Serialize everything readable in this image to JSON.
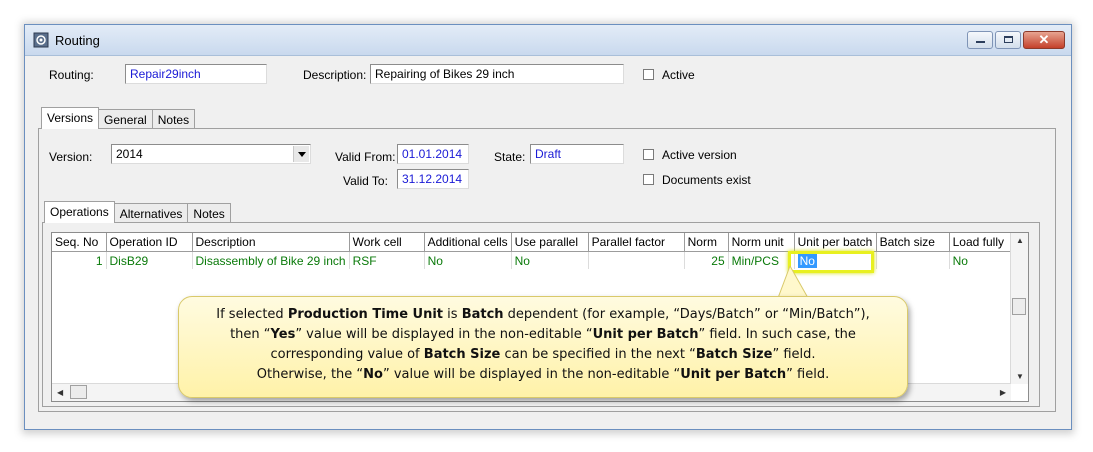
{
  "window": {
    "title": "Routing"
  },
  "header": {
    "routing_label": "Routing:",
    "routing_value": "Repair29inch",
    "description_label": "Description:",
    "description_value": "Repairing of Bikes 29 inch",
    "active_label": "Active"
  },
  "main_tabs": [
    "Versions",
    "General",
    "Notes"
  ],
  "version": {
    "version_label": "Version:",
    "version_value": "2014",
    "valid_from_label": "Valid From:",
    "valid_from_value": "01.01.2014",
    "valid_to_label": "Valid To:",
    "valid_to_value": "31.12.2014",
    "state_label": "State:",
    "state_value": "Draft",
    "active_version_label": "Active version",
    "documents_exist_label": "Documents exist"
  },
  "sub_tabs": [
    "Operations",
    "Alternatives",
    "Notes"
  ],
  "table": {
    "columns": [
      "Seq. No",
      "Operation ID",
      "Description",
      "Work cell",
      "Additional cells",
      "Use parallel",
      "Parallel factor",
      "Norm",
      "Norm unit",
      "Unit per batch",
      "Batch size",
      "Load fully"
    ],
    "rows": [
      [
        "1",
        "DisB29",
        "Disassembly of Bike 29 inch",
        "RSF",
        "No",
        "No",
        "",
        "25",
        "Min/PCS",
        "No",
        "",
        "No"
      ]
    ]
  },
  "callout": {
    "line1_a": "If selected ",
    "line1_b": "Production Time Unit",
    "line1_c": " is ",
    "line1_d": "Batch",
    "line1_e": " dependent (for example, “Days/Batch” or “Min/Batch”),",
    "line2_a": "then “",
    "line2_b": "Yes",
    "line2_c": "” value will be displayed in the non-editable “",
    "line2_d": "Unit per Batch",
    "line2_e": "” field.  In such case, the",
    "line3_a": "corresponding value of ",
    "line3_b": "Batch Size",
    "line3_c": " can be specified in the next “",
    "line3_d": "Batch Size",
    "line3_e": "” field.",
    "line4_a": "Otherwise, the “",
    "line4_b": "No",
    "line4_c": "” value will be displayed in the non-editable “",
    "line4_d": "Unit per Batch",
    "line4_e": "” field."
  }
}
